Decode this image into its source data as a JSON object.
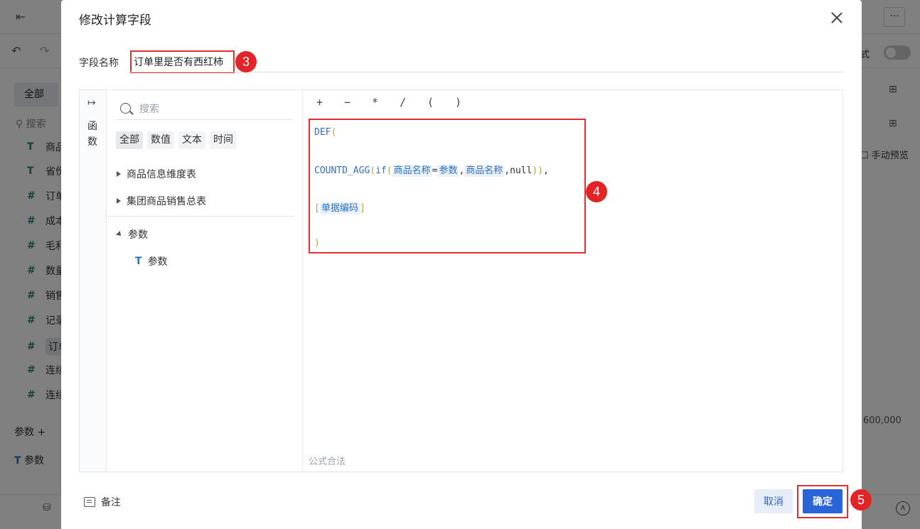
{
  "background": {
    "tab_all": "全部",
    "search_placeholder": "搜索",
    "fields": [
      {
        "icon": "T",
        "label": "商品"
      },
      {
        "icon": "T",
        "label": "省份"
      },
      {
        "icon": "#",
        "label": "订单"
      },
      {
        "icon": "#",
        "label": "成本"
      },
      {
        "icon": "#",
        "label": "毛利"
      },
      {
        "icon": "#",
        "label": "数量"
      },
      {
        "icon": "#",
        "label": "销售"
      },
      {
        "icon": "#",
        "label": "记录"
      },
      {
        "icon": "#",
        "label": "订单"
      },
      {
        "icon": "#",
        "label": "连续"
      },
      {
        "icon": "#",
        "label": "连续"
      }
    ],
    "params_header": "参数 +",
    "param_item": "参数",
    "mode_label": "式",
    "manual_preview": "手动预览",
    "axis_value": "600,000",
    "more": "···"
  },
  "dialog": {
    "title": "修改计算字段",
    "field_name_label": "字段名称",
    "field_name_value": "订单里是否有西红柿",
    "rail_label": "函数",
    "search_placeholder": "搜索",
    "categories": [
      "全部",
      "数值",
      "文本",
      "时间"
    ],
    "tree": {
      "table1": "商品信息维度表",
      "table2": "集团商品销售总表",
      "params_group": "参数",
      "param_item": "参数"
    },
    "operators": [
      "+",
      "−",
      "*",
      "/",
      "(",
      ")"
    ],
    "formula": {
      "l1_fn": "DEF",
      "l1_paren": "(",
      "l2_fn": "COUNTD_AGG",
      "l2_open": "(",
      "l2_if": "if",
      "l2_p1": "(",
      "l2_f1": "商品名称",
      "l2_eq": "=",
      "l2_param": "参数",
      "l2_comma1": ",",
      "l2_f2": "商品名称",
      "l2_rest": ",null",
      "l2_close": "))",
      "l2_comma2": ",",
      "l3_open": "[",
      "l3_field": "单据编码",
      "l3_close": "]",
      "l4_paren": ")"
    },
    "validation": "公式合法",
    "note_label": "备注",
    "cancel": "取消",
    "confirm": "确定"
  },
  "annotations": {
    "b3": "3",
    "b4": "4",
    "b5": "5"
  }
}
